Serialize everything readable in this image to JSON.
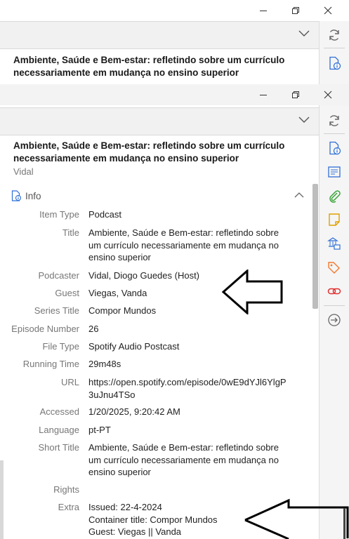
{
  "window": {
    "title": "Ambiente, Saúde e Bem-estar: refletindo sobre um currículo necessariamente em mudança no ensino superior",
    "creator_line": "Vidal",
    "controls": [
      "minimize-icon",
      "maximize-icon",
      "close-icon"
    ]
  },
  "back_window": {
    "title": "Ambiente, Saúde e Bem-estar: refletindo sobre um currículo necessariamente em mudança no ensino superior"
  },
  "sidebar": {
    "icons": [
      "sync-icon",
      "info-icon",
      "abstract-icon",
      "attachment-icon",
      "note-icon",
      "libraries-collections-icon",
      "tags-icon",
      "related-icon",
      "locate-icon"
    ]
  },
  "info_section": {
    "label": "Info",
    "fields": [
      {
        "key": "Item Type",
        "value": "Podcast"
      },
      {
        "key": "Title",
        "value": "Ambiente, Saúde e Bem-estar: refletindo sobre um currículo necessariamente em mudança no ensino superior"
      },
      {
        "key": "Podcaster",
        "value": "Vidal, Diogo Guedes (Host)"
      },
      {
        "key": "Guest",
        "value": "Viegas, Vanda"
      },
      {
        "key": "Series Title",
        "value": "Compor Mundos"
      },
      {
        "key": "Episode Number",
        "value": "26"
      },
      {
        "key": "File Type",
        "value": "Spotify Audio Postcast"
      },
      {
        "key": "Running Time",
        "value": "29m48s"
      },
      {
        "key": "URL",
        "value": "https://open.spotify.com/episode/0wE9dYJl6YlgP3uJnu4TSo"
      },
      {
        "key": "Accessed",
        "value": "1/20/2025, 9:20:42 AM"
      },
      {
        "key": "Language",
        "value": "pt-PT"
      },
      {
        "key": "Short Title",
        "value": "Ambiente, Saúde e Bem-estar: refletindo sobre um currículo necessariamente em mudança no ensino superior"
      },
      {
        "key": "Rights",
        "value": ""
      },
      {
        "key": "Extra",
        "value": "Issued: 22-4-2024\nContainer title: Compor Mundos\nGuest: Viegas || Vanda"
      }
    ]
  },
  "colors": {
    "accent_blue": "#2f6fd6",
    "annotation_arrow": "#000000"
  }
}
